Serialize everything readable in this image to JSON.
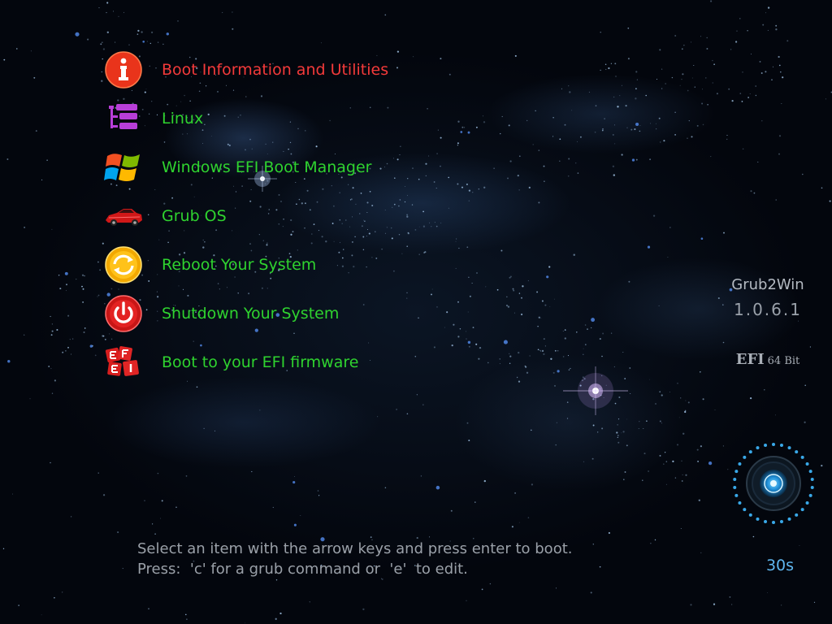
{
  "menu": {
    "selected_index": 0,
    "items": [
      {
        "label": "Boot Information and Utilities",
        "icon": "info-icon"
      },
      {
        "label": "Linux",
        "icon": "linux-list-icon"
      },
      {
        "label": "Windows EFI Boot Manager",
        "icon": "windows-logo-icon"
      },
      {
        "label": "Grub OS",
        "icon": "sports-car-icon"
      },
      {
        "label": "Reboot Your System",
        "icon": "reboot-icon"
      },
      {
        "label": "Shutdown Your System",
        "icon": "power-icon"
      },
      {
        "label": "Boot to your EFI firmware",
        "icon": "efi-logo-icon"
      }
    ]
  },
  "branding": {
    "name": "Grub2Win",
    "version": "1.0.6.1",
    "efi_label": "EFI",
    "bits_label": "64 Bit"
  },
  "hints": {
    "line1": "Select an item with the arrow keys and press enter to boot.",
    "line2": "Press:  'c' for a grub command or  'e'  to edit."
  },
  "timer": {
    "text": "30s"
  },
  "colors": {
    "selected_item": "#f43a3a",
    "menu_item": "#2fd32f",
    "hint_text": "#9aa0a8",
    "timer_text": "#5fb6ee",
    "background": "#03060d"
  }
}
